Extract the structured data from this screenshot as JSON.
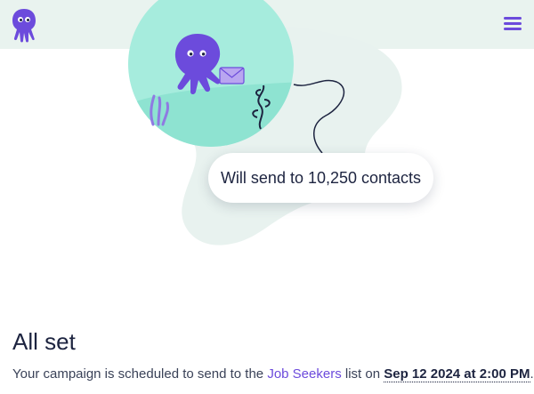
{
  "header": {
    "logo_icon": "octopus-logo-icon",
    "menu_icon": "hamburger-menu-icon",
    "accent_color": "#6c4bdc",
    "background_color": "#e9f3ef"
  },
  "illustration": {
    "icon": "octopus-fishbowl-illustration",
    "send_label": "Will send to 10,250 contacts"
  },
  "status": {
    "heading": "All set",
    "summary_prefix": "Your campaign is scheduled to send to the ",
    "list_name": "Job Seekers",
    "summary_middle": " list on ",
    "schedule": "Sep 12 2024 at 2:00 PM",
    "summary_suffix": "."
  }
}
